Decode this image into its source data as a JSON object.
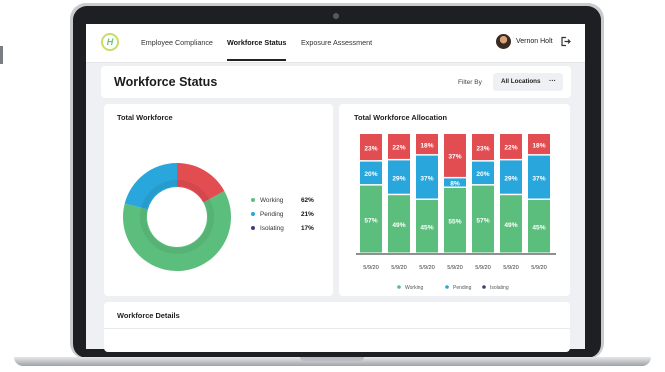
{
  "nav": {
    "logo_text": "H",
    "tabs": [
      "Employee Compliance",
      "Workforce Status",
      "Exposure Assessment"
    ],
    "active_tab": "Workforce Status",
    "user_name": "Vernon Holt"
  },
  "header": {
    "title": "Workforce Status",
    "filter_label": "Filter By",
    "filter_value": "All Locations",
    "filter_more": "···"
  },
  "total_workforce": {
    "title": "Total Workforce",
    "legend": [
      {
        "label": "Working",
        "value": "62%",
        "color": "#5cbe7d"
      },
      {
        "label": "Pending",
        "value": "21%",
        "color": "#29a6db"
      },
      {
        "label": "Isolating",
        "value": "17%",
        "color": "#e24d52"
      }
    ]
  },
  "allocation": {
    "title": "Total Workforce Allocation",
    "legend": [
      {
        "label": "Working",
        "color": "#5cbe7d"
      },
      {
        "label": "Pending",
        "color": "#29a6db"
      },
      {
        "label": "Isolating",
        "color": "#3d3f7a"
      }
    ]
  },
  "details": {
    "title": "Workforce Details"
  },
  "colors": {
    "working": "#5cbe7d",
    "pending": "#29a6db",
    "isolating": "#e24d52",
    "isolating_legend": "#3d3f7a"
  },
  "chart_data": [
    {
      "type": "pie",
      "categories": [
        "Working",
        "Pending",
        "Isolating"
      ],
      "values": [
        62,
        21,
        17
      ]
    },
    {
      "type": "bar",
      "stacked": true,
      "categories": [
        "5/9/20",
        "5/9/20",
        "5/9/20",
        "5/9/20",
        "5/9/20",
        "5/9/20",
        "5/9/20"
      ],
      "series": [
        {
          "name": "Working",
          "values": [
            57,
            49,
            45,
            55,
            57,
            49,
            45
          ]
        },
        {
          "name": "Pending",
          "values": [
            20,
            29,
            37,
            8,
            20,
            29,
            37
          ]
        },
        {
          "name": "Isolating",
          "values": [
            23,
            22,
            18,
            37,
            23,
            22,
            18
          ]
        }
      ],
      "ylim": [
        0,
        100
      ]
    }
  ]
}
